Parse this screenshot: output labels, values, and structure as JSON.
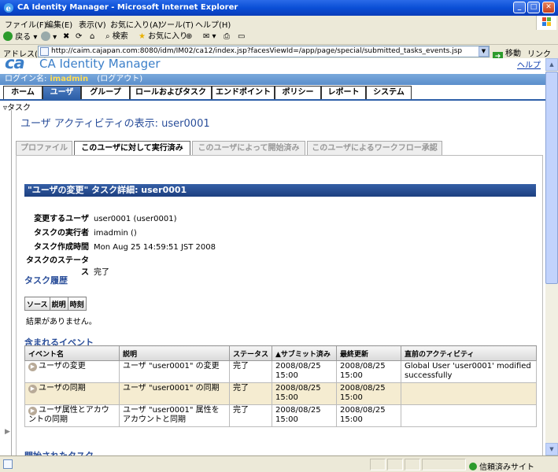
{
  "window": {
    "title": "CA Identity Manager - Microsoft Internet Explorer"
  },
  "menu": [
    "ファイル(F)",
    "編集(E)",
    "表示(V)",
    "お気に入り(A)",
    "ツール(T)",
    "ヘルプ(H)"
  ],
  "toolbar": {
    "back": "戻る",
    "search": "検索",
    "favorites": "お気に入り"
  },
  "address": {
    "label": "アドレス(D)",
    "url": "http://caim.cajapan.com:8080/idm/IM02/ca12/index.jsp?facesViewId=/app/page/special/submitted_tasks_events.jsp",
    "go": "移動",
    "links": "リンク"
  },
  "app": {
    "logo": "ca",
    "title": "CA Identity Manager",
    "help": "ヘルプ"
  },
  "login": {
    "label": "ログイン名:",
    "user": "imadmin",
    "logout": "(ログアウト)"
  },
  "nav_tabs": [
    "ホーム",
    "ユーザ",
    "グループ",
    "ロールおよびタスク",
    "エンドポイント",
    "ポリシー",
    "レポート",
    "システム"
  ],
  "sub_label": "タスク",
  "page_title": "ユーザ アクティビティの表示: user0001",
  "sub_tabs": [
    "プロファイル",
    "このユーザに対して実行済み",
    "このユーザによって開始済み",
    "このユーザによるワークフロー承認"
  ],
  "detail": {
    "header": "\"ユーザの変更\" タスク詳細: user0001",
    "fields": [
      {
        "key": "変更するユーザ",
        "value": "user0001 (user0001)"
      },
      {
        "key": "タスクの実行者",
        "value": "imadmin ()"
      },
      {
        "key": "タスク作成時間",
        "value": "Mon Aug 25 14:59:51 JST 2008"
      },
      {
        "key": "タスクのステータス",
        "value": "完了"
      }
    ]
  },
  "history": {
    "title": "タスク履歴",
    "columns": [
      "ソース",
      "説明",
      "時刻"
    ],
    "empty": "結果がありません。"
  },
  "events": {
    "title": "含まれるイベント",
    "columns": [
      "イベント名",
      "説明",
      "ステータス",
      "▲サブミット済み",
      "最終更新",
      "直前のアクティビティ"
    ],
    "rows": [
      {
        "name": "ユーザの変更",
        "desc": "ユーザ \"user0001\" の変更",
        "status": "完了",
        "submitted": "2008/08/25 15:00",
        "updated": "2008/08/25 15:00",
        "activity": "Global User 'user0001' modified successfully"
      },
      {
        "name": "ユーザの同期",
        "desc": "ユーザ \"user0001\" の同期",
        "status": "完了",
        "submitted": "2008/08/25 15:00",
        "updated": "2008/08/25 15:00",
        "activity": ""
      },
      {
        "name": "ユーザ属性とアカウントの同期",
        "desc": "ユーザ \"user0001\" 属性をアカウントと同期",
        "status": "完了",
        "submitted": "2008/08/25 15:00",
        "updated": "2008/08/25 15:00",
        "activity": ""
      }
    ]
  },
  "next_section": "開始されたタスク",
  "status": {
    "zone": "信頼済みサイト"
  }
}
